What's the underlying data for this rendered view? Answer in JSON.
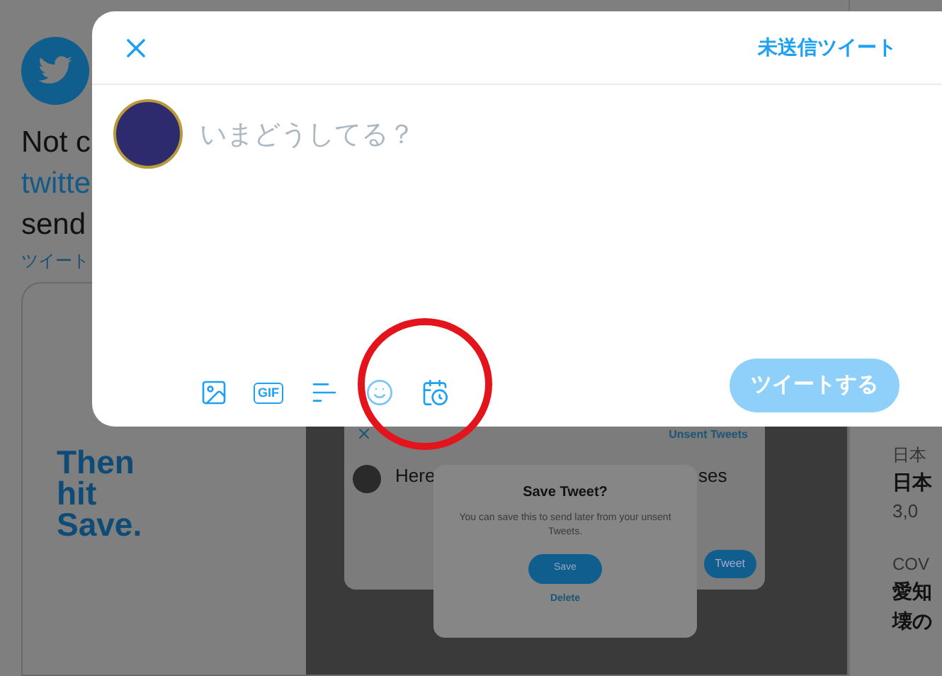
{
  "background_tweet": {
    "text_lines": [
      {
        "kind": "text",
        "text": "Not c"
      },
      {
        "kind": "link",
        "text": "twitte"
      },
      {
        "kind": "text",
        "text": "send"
      }
    ],
    "caption": "ツイート",
    "card_heading": "Then\nhit\nSave.",
    "video_frame": {
      "header_link": "Unsent Tweets",
      "draft_start": "Here",
      "draft_end": "ses",
      "tweet_button": "Tweet",
      "dialog": {
        "title": "Save Tweet?",
        "message": "You can save this to send later from your unsent Tweets.",
        "save_button": "Save",
        "delete_button": "Delete"
      }
    }
  },
  "sidebar_trends": [
    {
      "category": "日本",
      "title": "日本",
      "count": "3,0"
    },
    {
      "category": "COV",
      "title": "愛知",
      "title_2": "壊の"
    }
  ],
  "compose_modal": {
    "unsent_link": "未送信ツイート",
    "placeholder": "いまどうしてる？",
    "toolbar": [
      {
        "kind": "image",
        "highlighted": false
      },
      {
        "kind": "gif",
        "label": "GIF",
        "highlighted": false
      },
      {
        "kind": "poll",
        "highlighted": false
      },
      {
        "kind": "emoji",
        "highlighted": false
      },
      {
        "kind": "schedule",
        "highlighted": true
      }
    ],
    "tweet_button": {
      "label": "ツイートする",
      "disabled": true
    }
  }
}
